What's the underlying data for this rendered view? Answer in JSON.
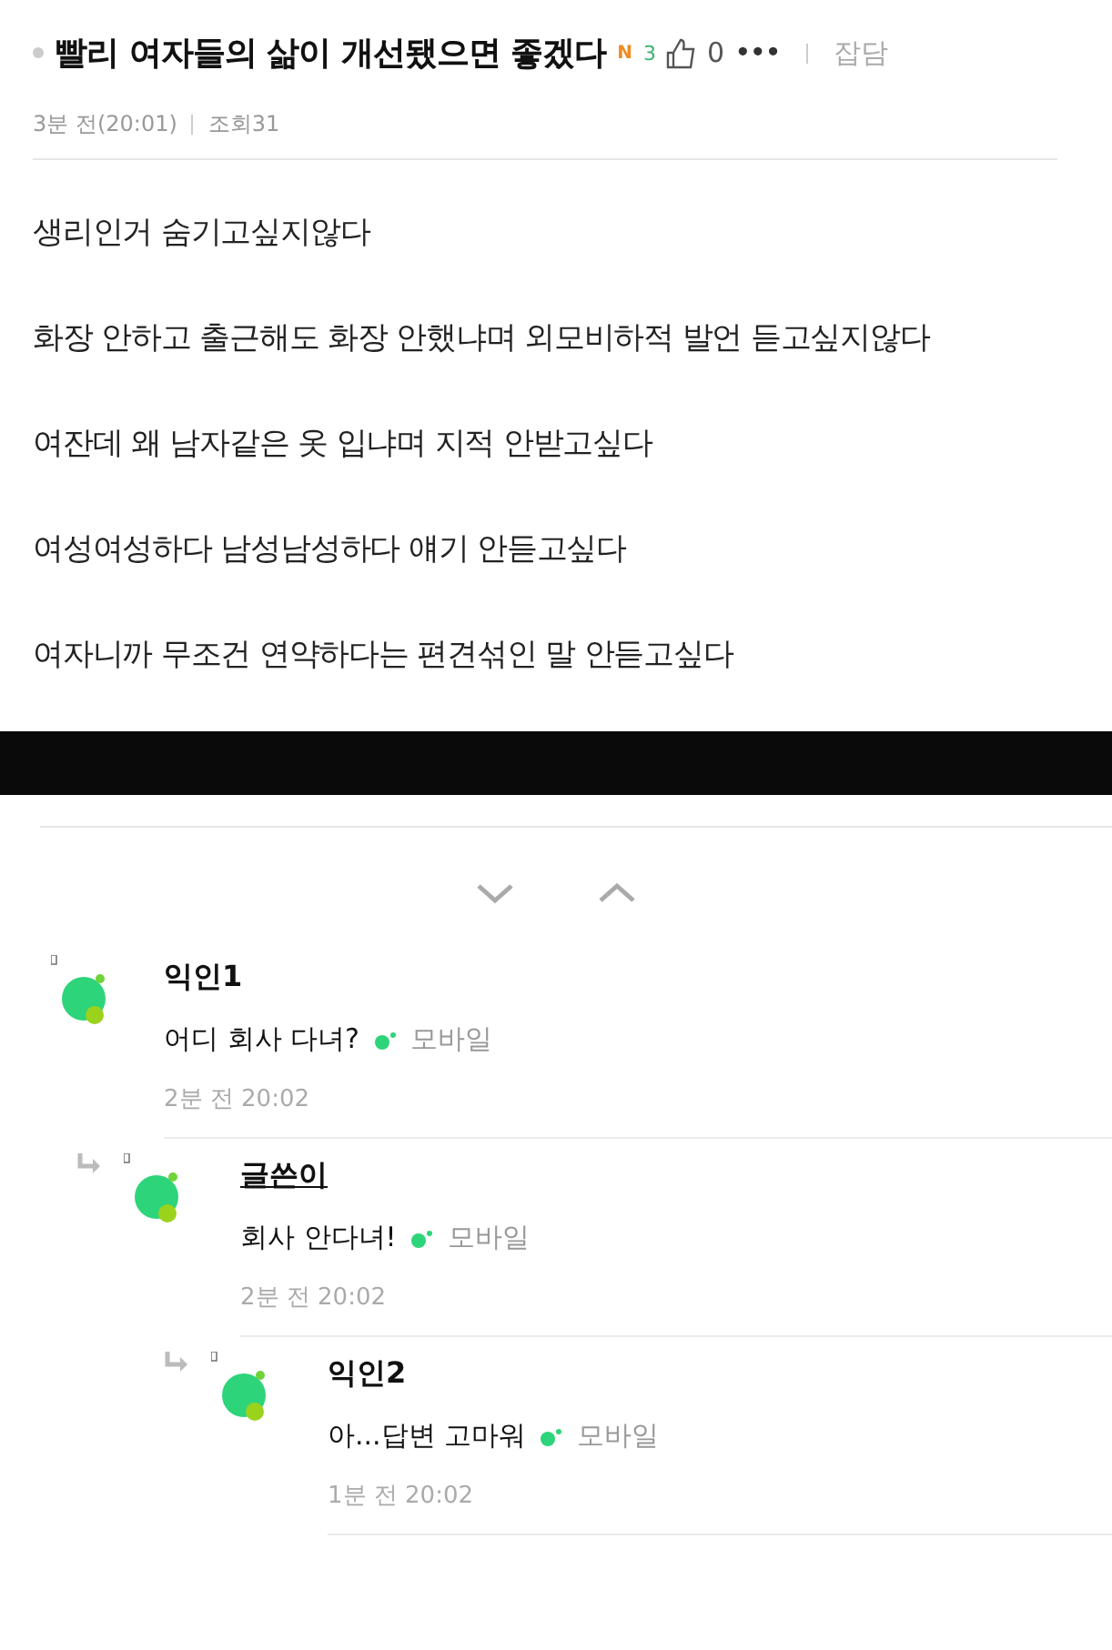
{
  "post": {
    "title": "빨리 여자들의 삶이 개선됐으면 좋겠다",
    "new_badge": "N",
    "comment_count": "3",
    "likes": "0",
    "more": "•••",
    "category": "잡담",
    "time": "3분 전(20:01)",
    "views": "조회31",
    "lines": [
      "생리인거 숨기고싶지않다",
      "화장 안하고 출근해도 화장 안했냐며 외모비하적 발언 듣고싶지않다",
      "여잔데 왜 남자같은 옷 입냐며 지적 안받고싶다",
      "여성여성하다 남성남성하다 얘기 안듣고싶다",
      "여자니까 무조건 연약하다는 편견섞인 말 안듣고싶다"
    ]
  },
  "comments": [
    {
      "nickname": "익인1",
      "is_author": false,
      "text": "어디 회사 다녀?",
      "device": "모바일",
      "time": "2분 전 20:02",
      "children": [
        {
          "nickname": "글쓴이",
          "is_author": true,
          "text": "회사 안다녀!",
          "device": "모바일",
          "time": "2분 전 20:02",
          "children": [
            {
              "nickname": "익인2",
              "is_author": false,
              "text": "아...답변 고마워",
              "device": "모바일",
              "time": "1분 전 20:02"
            }
          ]
        }
      ]
    }
  ]
}
